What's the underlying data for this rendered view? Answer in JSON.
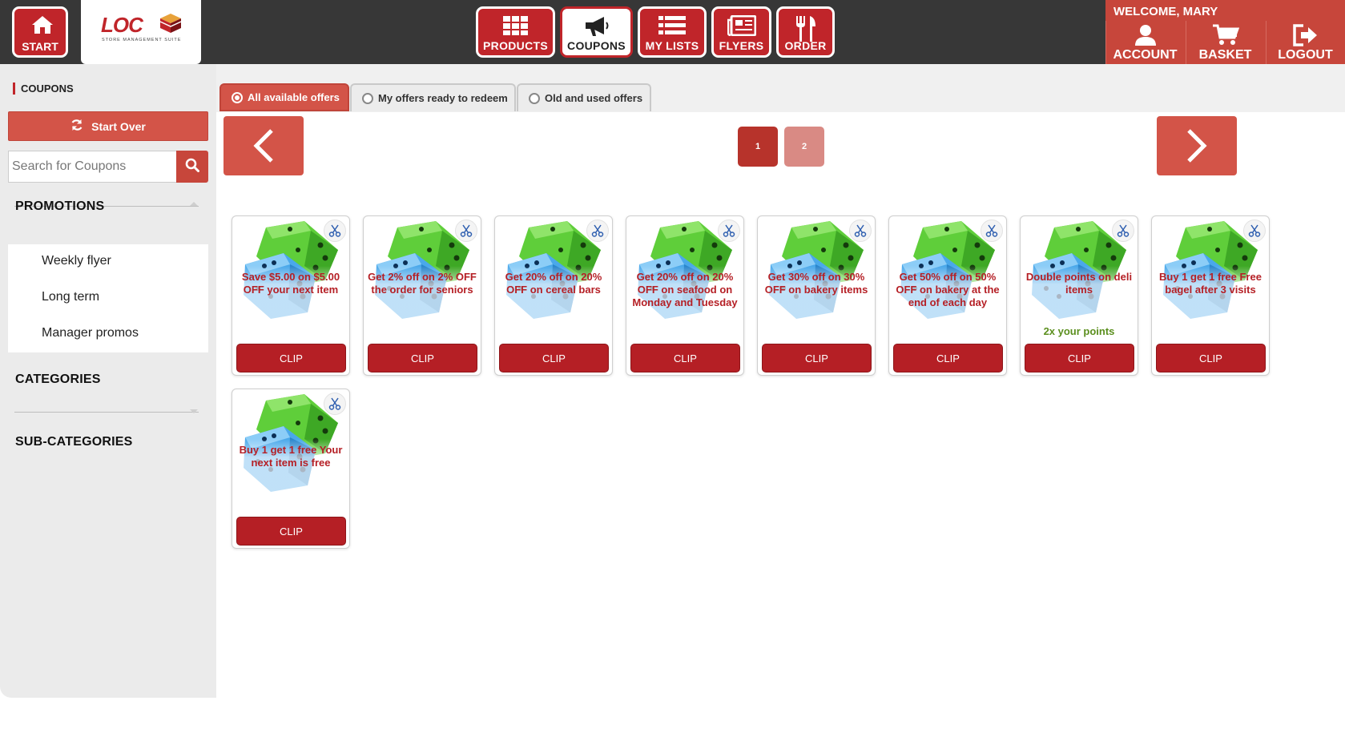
{
  "header": {
    "start_label": "START",
    "logo_text": "LOC",
    "logo_sub": "STORE MANAGEMENT SUITE",
    "nav": [
      {
        "label": "PRODUCTS",
        "icon": "grid-icon"
      },
      {
        "label": "COUPONS",
        "icon": "megaphone-icon",
        "active": true
      },
      {
        "label": "MY LISTS",
        "icon": "list-icon"
      },
      {
        "label": "FLYERS",
        "icon": "newspaper-icon"
      },
      {
        "label": "ORDER",
        "icon": "utensils-icon"
      }
    ],
    "welcome": "WELCOME, MARY",
    "user_actions": [
      {
        "label": "ACCOUNT",
        "icon": "user-icon"
      },
      {
        "label": "BASKET",
        "icon": "cart-icon"
      },
      {
        "label": "LOGOUT",
        "icon": "logout-icon"
      }
    ]
  },
  "sidebar": {
    "title": "COUPONS",
    "start_over": "Start Over",
    "search_placeholder": "Search for Coupons",
    "promotions": {
      "heading": "PROMOTIONS",
      "items": [
        "Weekly flyer",
        "Long term",
        "Manager promos"
      ]
    },
    "categories_heading": "CATEGORIES",
    "subcategories_heading": "SUB-CATEGORIES"
  },
  "tabs": [
    {
      "label": "All available offers",
      "active": true
    },
    {
      "label": "My offers ready to redeem",
      "active": false
    },
    {
      "label": "Old and used offers",
      "active": false
    }
  ],
  "pagination": {
    "pages": [
      "1",
      "2"
    ],
    "current": "1"
  },
  "coupons": [
    {
      "title": "Save $5.00 on $5.00 OFF your next item",
      "sub": "",
      "clip": "CLIP"
    },
    {
      "title": "Get 2% off on 2% OFF the order for seniors",
      "sub": "",
      "clip": "CLIP"
    },
    {
      "title": "Get 20% off on 20% OFF on cereal bars",
      "sub": "",
      "clip": "CLIP"
    },
    {
      "title": "Get 20% off on 20% OFF on seafood on Monday and Tuesday",
      "sub": "",
      "clip": "CLIP"
    },
    {
      "title": "Get 30% off on 30% OFF on bakery items",
      "sub": "",
      "clip": "CLIP"
    },
    {
      "title": "Get 50% off on 50% OFF on bakery at the end of each day",
      "sub": "",
      "clip": "CLIP"
    },
    {
      "title": "Double points on deli items",
      "sub": "2x your points",
      "clip": "CLIP"
    },
    {
      "title": "Buy 1 get 1 free Free bagel after 3 visits",
      "sub": "",
      "clip": "CLIP"
    },
    {
      "title": "Buy 1 get 1 free Your next item is free",
      "sub": "",
      "clip": "CLIP"
    }
  ],
  "colors": {
    "brand_red": "#c0252a",
    "accent_red": "#d35448",
    "clip_red": "#b51f25",
    "sub_green": "#5b8f1e",
    "topbar": "#373737"
  }
}
